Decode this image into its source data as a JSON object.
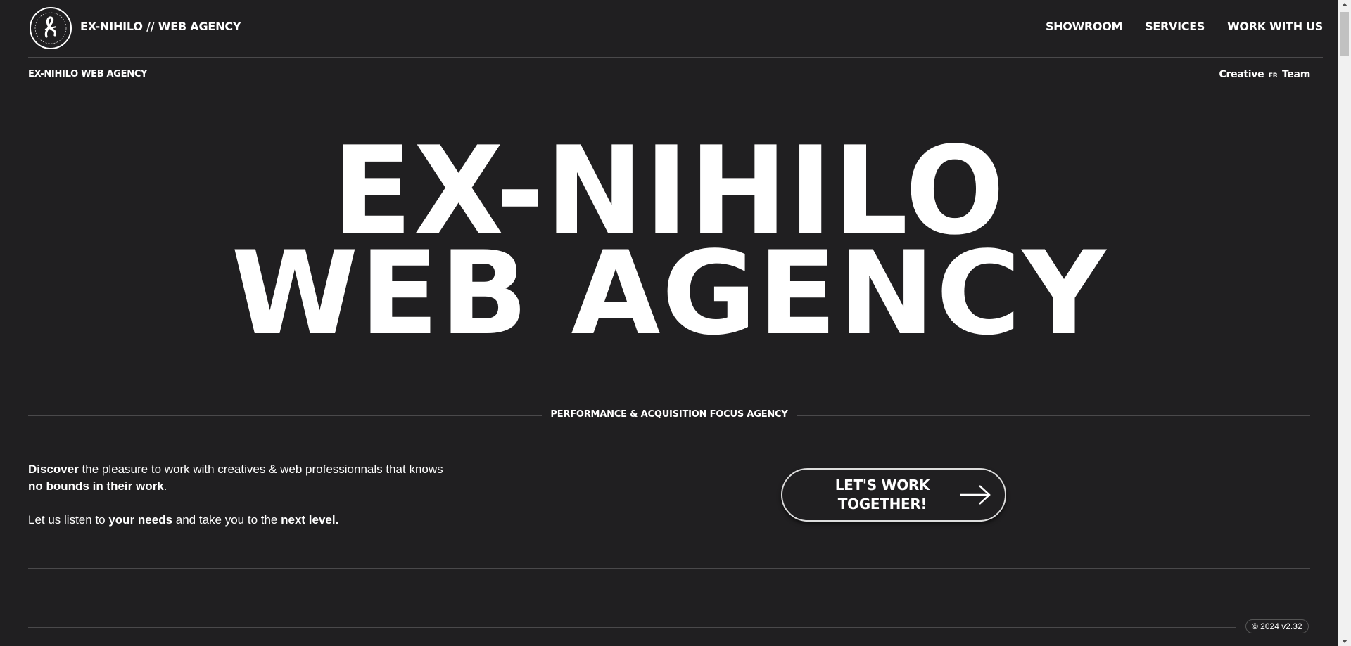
{
  "header": {
    "brand": "EX-NIHILO // WEB AGENCY",
    "logo_icon": "ex-nihilo-circular-logo",
    "nav": [
      "SHOWROOM",
      "SERVICES",
      "WORK WITH US"
    ]
  },
  "subheader": {
    "left": "EX-NIHILO WEB AGENCY",
    "right_prefix": "Creative",
    "right_lang": "FR",
    "right_suffix": "Team"
  },
  "hero": {
    "line1": "EX-NIHILO",
    "line2": "WEB AGENCY"
  },
  "tagline": "PERFORMANCE & ACQUISITION FOCUS AGENCY",
  "intro": {
    "p1_bold1": "Discover",
    "p1_text1": " the pleasure to work with creatives & web professionnals that knows ",
    "p1_bold2": "no bounds in their work",
    "p1_end": ".",
    "p2_text1": "Let us listen to ",
    "p2_bold1": "your needs",
    "p2_text2": " and take you to the ",
    "p2_bold2": "next level."
  },
  "cta": {
    "label_line1": "LET'S WORK",
    "label_line2": "TOGETHER!",
    "icon": "arrow-right-icon"
  },
  "footer": {
    "version": "© 2024 v2.32"
  },
  "colors": {
    "background": "#201f21",
    "text": "#ffffff",
    "divider": "#4a494b"
  }
}
